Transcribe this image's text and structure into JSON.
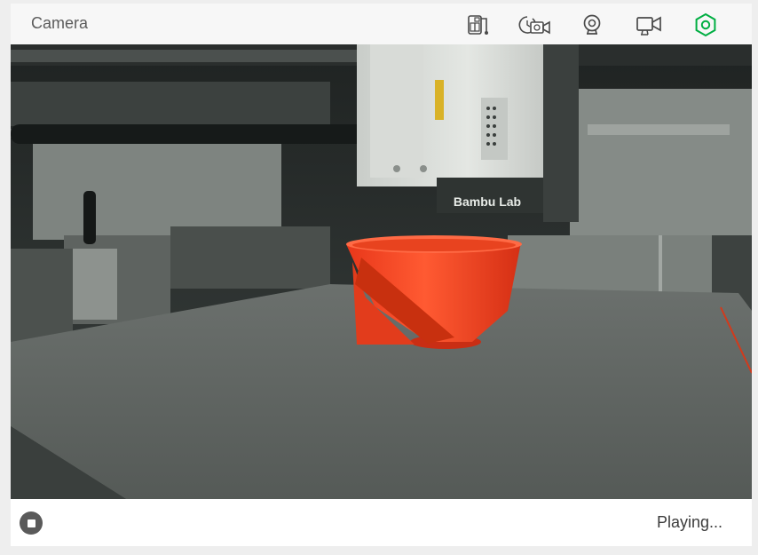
{
  "header": {
    "title": "Camera",
    "icons": [
      {
        "name": "sd-card-files-icon"
      },
      {
        "name": "timelapse-icon"
      },
      {
        "name": "webcam-icon"
      },
      {
        "name": "video-record-icon"
      },
      {
        "name": "connection-status-icon",
        "color": "#00ae42"
      }
    ]
  },
  "video": {
    "nameplate": "Bambu Lab"
  },
  "footer": {
    "status": "Playing..."
  },
  "colors": {
    "accent": "#00ae42",
    "print_object": "#f2411c",
    "icon": "#4a4a4a"
  }
}
